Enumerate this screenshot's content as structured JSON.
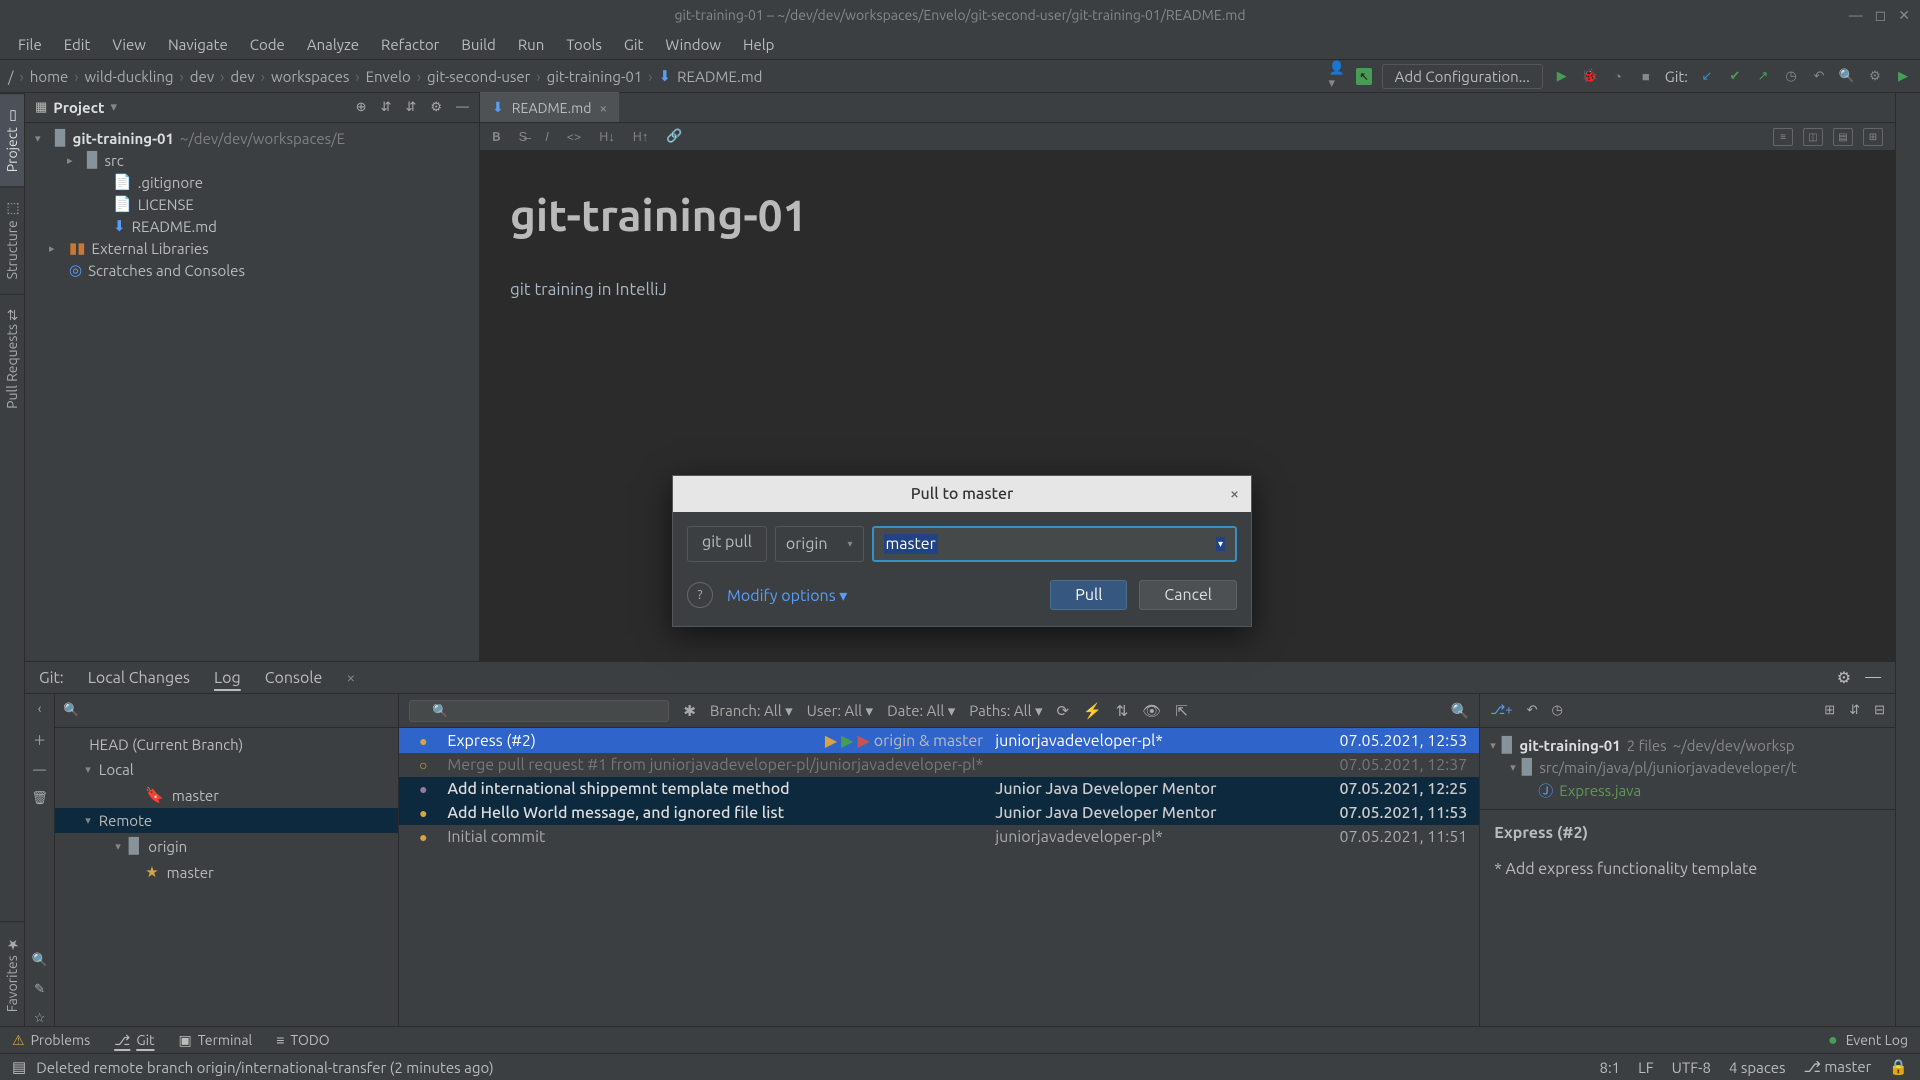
{
  "window": {
    "title": "git-training-01 – ~/dev/dev/workspaces/Envelo/git-second-user/git-training-01/README.md"
  },
  "menu": [
    "File",
    "Edit",
    "View",
    "Navigate",
    "Code",
    "Analyze",
    "Refactor",
    "Build",
    "Run",
    "Tools",
    "Git",
    "Window",
    "Help"
  ],
  "breadcrumbs": [
    "/",
    "home",
    "wild-duckling",
    "dev",
    "dev",
    "workspaces",
    "Envelo",
    "git-second-user",
    "git-training-01",
    "README.md"
  ],
  "run_config": "Add Configuration...",
  "git_label": "Git:",
  "sidestrip": {
    "project": "Project",
    "structure": "Structure",
    "pull_requests": "Pull Requests",
    "favorites": "Favorites"
  },
  "project": {
    "title": "Project",
    "root": "git-training-01",
    "root_path": "~/dev/dev/workspaces/E",
    "items": [
      "src",
      ".gitignore",
      "LICENSE",
      "README.md"
    ],
    "external": "External Libraries",
    "scratches": "Scratches and Consoles"
  },
  "editor": {
    "tab": "README.md",
    "h1": "git-training-01",
    "body": "git training in IntelliJ"
  },
  "dialog": {
    "title": "Pull to master",
    "cmd": "git pull",
    "remote": "origin",
    "branch": "master",
    "modify": "Modify options",
    "pull": "Pull",
    "cancel": "Cancel"
  },
  "git_panel": {
    "label": "Git:",
    "tabs": [
      "Local Changes",
      "Log",
      "Console"
    ],
    "filters": {
      "branch": "Branch: All",
      "user": "User: All",
      "date": "Date: All",
      "paths": "Paths: All"
    },
    "branches": {
      "head": "HEAD (Current Branch)",
      "local": "Local",
      "local_items": [
        "master"
      ],
      "remote": "Remote",
      "remote_items": {
        "origin": "origin",
        "branches": [
          "master"
        ]
      }
    },
    "commits": [
      {
        "msg": "Express (#2)",
        "tags": "origin & master",
        "author": "juniorjavadeveloper-pl*",
        "date": "07.05.2021, 12:53",
        "sel": "main"
      },
      {
        "msg": "Merge pull request #1 from juniorjavadeveloper-pl/juniorjavadeveloper-pl*",
        "author": "",
        "date": "07.05.2021, 12:37",
        "dim": true
      },
      {
        "msg": "Add international shippemnt template method",
        "author": "Junior Java Developer Mentor",
        "date": "07.05.2021, 12:25",
        "sel": "sub"
      },
      {
        "msg": "Add Hello World message, and ignored file list",
        "author": "Junior Java Developer Mentor",
        "date": "07.05.2021, 11:53",
        "sel": "sub"
      },
      {
        "msg": "Initial commit",
        "author": "juniorjavadeveloper-pl*",
        "date": "07.05.2021, 11:51"
      }
    ],
    "details": {
      "root": "git-training-01",
      "root_meta": "2 files",
      "root_path": "~/dev/dev/worksp",
      "pkg": "src/main/java/pl/juniorjavadeveloper/t",
      "file": "Express.java",
      "commit_title": "Express (#2)",
      "commit_body": "* Add express functionality template"
    }
  },
  "toolstrip": {
    "problems": "Problems",
    "git": "Git",
    "terminal": "Terminal",
    "todo": "TODO",
    "event_log": "Event Log"
  },
  "status": {
    "msg": "Deleted remote branch origin/international-transfer (2 minutes ago)",
    "pos": "8:1",
    "lf": "LF",
    "enc": "UTF-8",
    "indent": "4 spaces",
    "branch": "master"
  }
}
